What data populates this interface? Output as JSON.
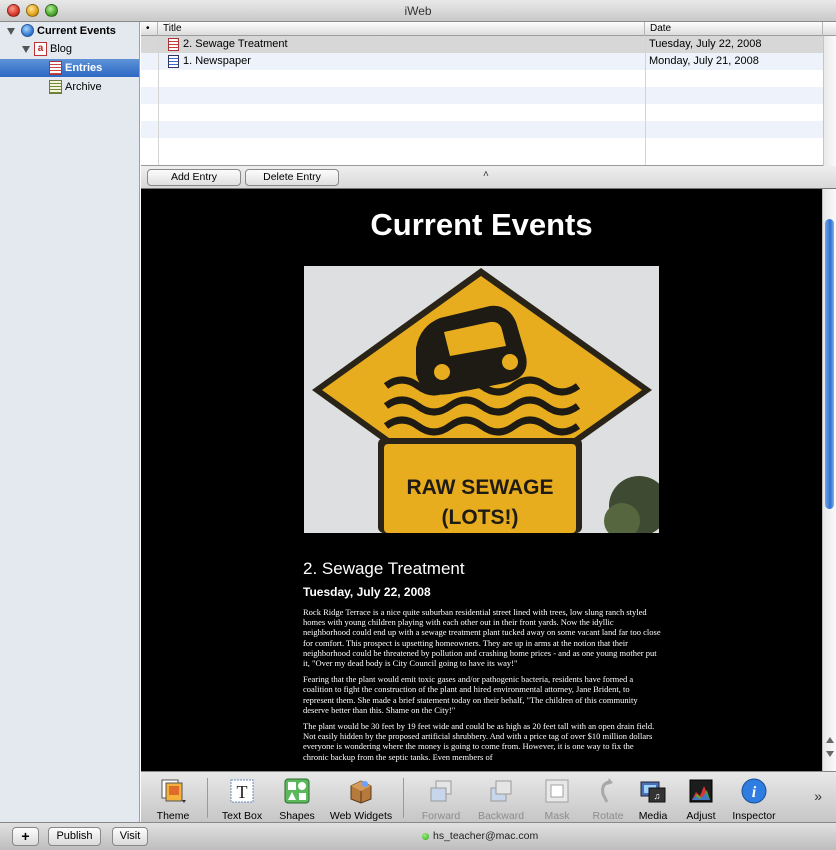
{
  "window": {
    "title": "iWeb"
  },
  "sidebar": {
    "items": [
      {
        "label": "Current Events",
        "icon": "globe-icon",
        "bold": true
      },
      {
        "label": "Blog",
        "icon": "blog-icon"
      },
      {
        "label": "Entries",
        "icon": "page-icon",
        "selected": true
      },
      {
        "label": "Archive",
        "icon": "archive-icon"
      }
    ]
  },
  "entries_table": {
    "columns": [
      "•",
      "Title",
      "Date"
    ],
    "rows": [
      {
        "title": "2. Sewage Treatment",
        "date": "Tuesday, July 22, 2008",
        "selected": true
      },
      {
        "title": "1. Newspaper",
        "date": "Monday, July 21, 2008",
        "selected": false
      }
    ]
  },
  "entry_bar": {
    "add_label": "Add Entry",
    "delete_label": "Delete Entry",
    "collapse_glyph": "˄"
  },
  "page": {
    "title": "Current Events",
    "image": {
      "sign_text_line1": "RAW SEWAGE",
      "sign_text_line2": "(LOTS!)"
    },
    "post_title": "2. Sewage Treatment",
    "post_date": "Tuesday, July 22, 2008",
    "paragraphs": [
      "Rock Ridge Terrace is a nice quite suburban residential street lined with trees, low slung ranch styled homes with young children playing with each other out in their front yards.  Now the idyllic neighborhood could end up with a sewage treatment plant tucked away on some vacant land far too close for comfort.  This prospect is upsetting homeowners.  They are up in arms at the notion that their neighborhood could be threatened by pollution and crashing home prices - and as one young mother put it, \"Over my dead body is City Council going to have its way!\"",
      "Fearing that the plant would emit toxic gases and/or pathogenic bacteria, residents have formed a coalition to fight the construction of the plant and hired environmental attorney, Jane Brident, to represent them.  She made a brief statement today on their behalf,  \"The children of this community deserve better than this.  Shame on the City!\"",
      "The plant would be 30 feet by 19 feet wide and could be as high as 20 feet tall with an open drain field. Not easily hidden by the proposed artificial shrubbery.  And with a price tag of over $10 million dollars everyone is wondering where the money is going to come from.  However, it is  one way to fix the chronic backup from the septic tanks.  Even members of"
    ]
  },
  "toolbar": {
    "tools": [
      {
        "label": "Theme",
        "icon": "theme-icon",
        "enabled": true
      },
      {
        "label": "Text Box",
        "icon": "text-box-icon",
        "enabled": true
      },
      {
        "label": "Shapes",
        "icon": "shapes-icon",
        "enabled": true
      },
      {
        "label": "Web Widgets",
        "icon": "web-widgets-icon",
        "enabled": true
      },
      {
        "label": "Forward",
        "icon": "forward-icon",
        "enabled": false
      },
      {
        "label": "Backward",
        "icon": "backward-icon",
        "enabled": false
      },
      {
        "label": "Mask",
        "icon": "mask-icon",
        "enabled": false
      },
      {
        "label": "Rotate",
        "icon": "rotate-icon",
        "enabled": false
      },
      {
        "label": "Media",
        "icon": "media-icon",
        "enabled": true
      },
      {
        "label": "Adjust",
        "icon": "adjust-icon",
        "enabled": true
      },
      {
        "label": "Inspector",
        "icon": "inspector-icon",
        "enabled": true
      }
    ],
    "overflow_glyph": "»"
  },
  "statusbar": {
    "add_glyph": "+",
    "publish_label": "Publish",
    "visit_label": "Visit",
    "account": "hs_teacher@mac.com"
  },
  "colors": {
    "selection_blue": "#2d68c4",
    "canvas_bg": "#000000",
    "sign_yellow": "#e8ad1e"
  }
}
